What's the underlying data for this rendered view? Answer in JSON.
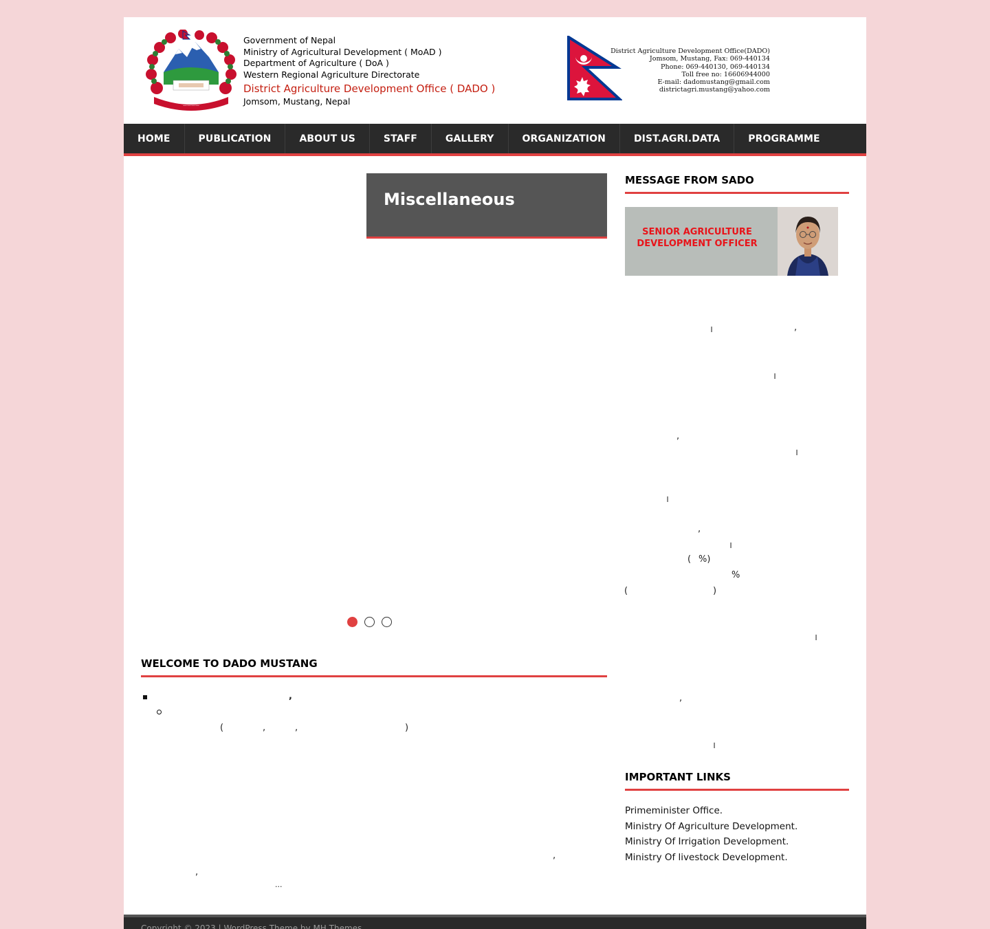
{
  "header": {
    "gov_lines": [
      "Government of Nepal",
      "Ministry of Agricultural Development ( MoAD )",
      "Department of Agriculture ( DoA )",
      "Western Regional Agriculture Directorate"
    ],
    "office_name": "District Agriculture Development Office ( DADO )",
    "office_location": "Jomsom, Mustang, Nepal",
    "contact_lines": [
      "District Agriculture Development Office(DADO)",
      "Jomsom, Mustang, Fax: 069-440134",
      "Phone: 069-440130, 069-440134",
      "Toll free no: 16606944000",
      "E-mail: dadomustang@gmail.com",
      "districtagri.mustang@yahoo.com"
    ],
    "emblem_icon": "nepal-emblem-icon",
    "flag_icon": "nepal-flag-icon",
    "colors": {
      "dado_red": "#c41e10",
      "flag_red": "#dc143c",
      "flag_blue": "#003893"
    }
  },
  "nav": {
    "items": [
      "HOME",
      "PUBLICATION",
      "ABOUT US",
      "STAFF",
      "GALLERY",
      "ORGANIZATION",
      "DIST.AGRI.DATA",
      "PROGRAMME"
    ],
    "colors": {
      "bar": "#2a2a2a",
      "accent": "#e04141"
    }
  },
  "slider": {
    "caption": "Miscellaneous",
    "slide_count": 3,
    "active_slide": 1
  },
  "welcome": {
    "title": "WELCOME TO DADO MUSTANG",
    "fragments": {
      "f1": ",",
      "f2": "(",
      "f3": ",",
      "f4": ",",
      "f5": ")",
      "f6": ",",
      "f7": ",",
      "f8": "..."
    }
  },
  "sidebar": {
    "sado_title": "MESSAGE FROM SADO",
    "banner_text": "SENIOR AGRICULTURE DEVELOPMENT OFFICER",
    "message_fragments": {
      "m1": "।",
      "m2": ",",
      "m3": "।",
      "m4": ",",
      "m5": "।",
      "m6": "।",
      "m7": ",",
      "m8": "।",
      "m9": "(",
      "m10": "%)",
      "m11": "%",
      "m12": "(",
      "m13": ")",
      "m14": "।",
      "m15": ",",
      "m16": "।"
    },
    "links_title": "IMPORTANT LINKS",
    "links": [
      "Primeminister Office.",
      "Ministry Of Agriculture Development.",
      "Ministry Of Irrigation Development.",
      "Ministry Of livestock Development."
    ]
  },
  "footer": {
    "text": "Copyright © 2023 | WordPress Theme by MH Themes"
  },
  "colors": {
    "page_bg": "#f5d6d8",
    "accent": "#e04141",
    "caption_bg": "#555555"
  }
}
